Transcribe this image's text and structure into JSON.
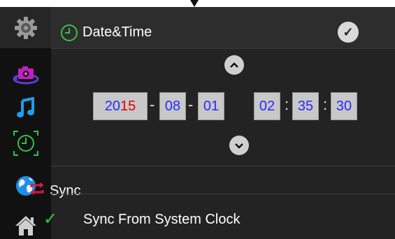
{
  "header": {
    "title": "Date&Time",
    "confirm_icon": "checkmark-icon"
  },
  "sidebar": {
    "items": [
      {
        "icon": "gear-icon",
        "active": true
      },
      {
        "icon": "camera-rotate-icon"
      },
      {
        "icon": "music-note-icon"
      },
      {
        "icon": "clock-focus-icon"
      },
      {
        "icon": "globe-icon"
      },
      {
        "icon": "home-icon"
      }
    ]
  },
  "datetime": {
    "year_prefix": "20",
    "year_suffix": "15",
    "month": "08",
    "day": "01",
    "hour": "02",
    "minute": "35",
    "second": "30",
    "date_separator": "-",
    "time_separator": ":"
  },
  "sync": {
    "title": "Sync",
    "option_label": "Sync From System Clock",
    "option_selected": true
  },
  "colors": {
    "value_blue": "#2a2aff",
    "year_highlight": "#e00000",
    "accent_green": "#27d43a",
    "sync_red": "#e0163d"
  }
}
